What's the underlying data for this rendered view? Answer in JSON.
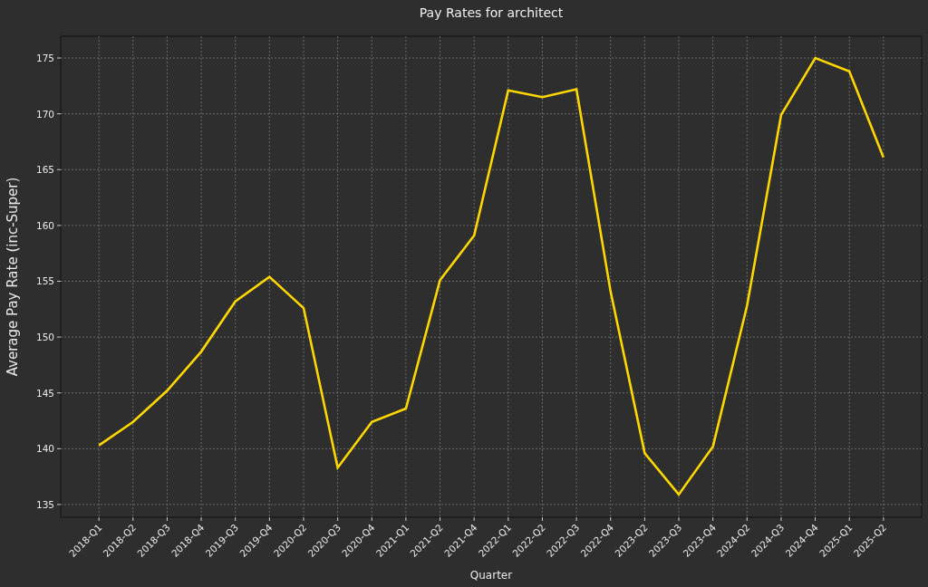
{
  "chart_data": {
    "type": "line",
    "title": "Pay Rates for architect",
    "xlabel": "Quarter",
    "ylabel": "Average Pay Rate (inc-Super)",
    "categories": [
      "2018-Q1",
      "2018-Q2",
      "2018-Q3",
      "2018-Q4",
      "2019-Q3",
      "2019-Q4",
      "2020-Q2",
      "2020-Q3",
      "2020-Q4",
      "2021-Q1",
      "2021-Q2",
      "2021-Q4",
      "2022-Q1",
      "2022-Q2",
      "2022-Q3",
      "2022-Q4",
      "2023-Q2",
      "2023-Q3",
      "2023-Q4",
      "2024-Q2",
      "2024-Q3",
      "2024-Q4",
      "2025-Q1",
      "2025-Q2"
    ],
    "grid": true,
    "series": [
      {
        "color": "#ffd700",
        "values": [
          140.3,
          142.4,
          145.2,
          148.7,
          153.2,
          155.4,
          152.6,
          138.3,
          142.4,
          143.6,
          155.1,
          159.1,
          172.1,
          171.5,
          172.2,
          154.1,
          139.6,
          135.9,
          140.2,
          152.8,
          169.9,
          175.0,
          173.8,
          166.1
        ]
      }
    ],
    "ylim": [
      133.86,
      176.95
    ],
    "yticks": [
      135,
      140,
      145,
      150,
      155,
      160,
      165,
      170,
      175
    ]
  }
}
